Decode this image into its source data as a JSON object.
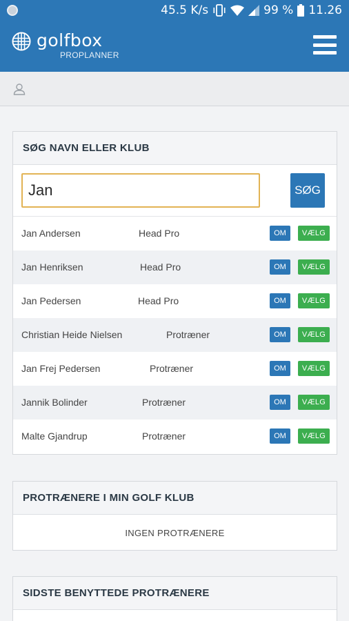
{
  "statusbar": {
    "speed": "45.5 K/s",
    "battery": "99 %",
    "time": "11.26"
  },
  "appbar": {
    "logo_text": "golfbox",
    "logo_sub": "PROPLANNER",
    "menu_icon": "hamburger-menu-icon"
  },
  "userbar": {
    "icon": "user-icon"
  },
  "search": {
    "title": "SØG NAVN ELLER KLUB",
    "value": "Jan",
    "button_label": "SØG",
    "results": [
      {
        "name": "Jan Andersen",
        "role": "Head Pro",
        "om_label": "OM",
        "select_label": "VÆLG"
      },
      {
        "name": "Jan Henriksen",
        "role": "Head Pro",
        "om_label": "OM",
        "select_label": "VÆLG"
      },
      {
        "name": "Jan Pedersen",
        "role": "Head Pro",
        "om_label": "OM",
        "select_label": "VÆLG"
      },
      {
        "name": "Christian Heide Nielsen",
        "role": "Protræner",
        "om_label": "OM",
        "select_label": "VÆLG"
      },
      {
        "name": "Jan Frej Pedersen",
        "role": "Protræner",
        "om_label": "OM",
        "select_label": "VÆLG"
      },
      {
        "name": "Jannik Bolinder",
        "role": "Protræner",
        "om_label": "OM",
        "select_label": "VÆLG"
      },
      {
        "name": "Malte Gjandrup",
        "role": "Protræner",
        "om_label": "OM",
        "select_label": "VÆLG"
      }
    ]
  },
  "club_panel": {
    "title": "PROTRÆNERE I MIN GOLF KLUB",
    "empty_text": "INGEN PROTRÆNERE"
  },
  "recent_panel": {
    "title": "SIDSTE BENYTTEDE PROTRÆNERE"
  },
  "colors": {
    "primary": "#2c77b6",
    "accent_green": "#3cae4f",
    "input_focus": "#e2b354"
  }
}
